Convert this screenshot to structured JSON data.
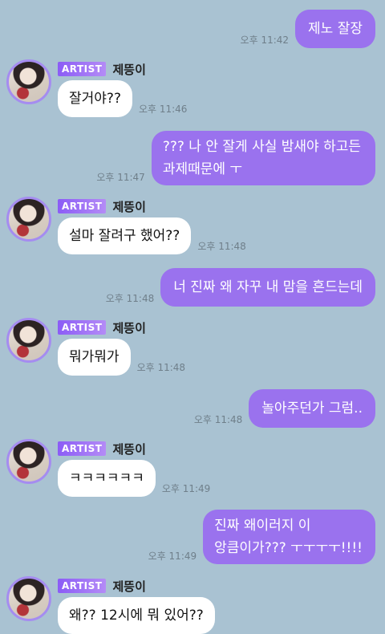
{
  "messages": [
    {
      "dir": "out",
      "lines": [
        "제노 잘장"
      ],
      "time": "오후 11:42"
    },
    {
      "dir": "in",
      "badge": "ARTIST",
      "name": "제뜽이",
      "text": "잘거야??",
      "time": "오후 11:46"
    },
    {
      "dir": "out",
      "lines": [
        "??? 나 안 잘게 사실 밤새야 하고든",
        "과제때문에 ㅜ"
      ],
      "time": "오후 11:47"
    },
    {
      "dir": "in",
      "badge": "ARTIST",
      "name": "제뜽이",
      "text": "설마 잘려구 했어??",
      "time": "오후 11:48"
    },
    {
      "dir": "out",
      "lines": [
        "너 진짜 왜 자꾸 내 맘을 흔드는데"
      ],
      "time": "오후 11:48"
    },
    {
      "dir": "in",
      "badge": "ARTIST",
      "name": "제뜽이",
      "text": "뭐가뭐가",
      "time": "오후 11:48"
    },
    {
      "dir": "out",
      "lines": [
        "놀아주던가 그럼.."
      ],
      "time": "오후 11:48"
    },
    {
      "dir": "in",
      "badge": "ARTIST",
      "name": "제뜽이",
      "text": "ㅋㅋㅋㅋㅋㅋ",
      "time": "오후 11:49"
    },
    {
      "dir": "out",
      "lines": [
        "진짜 왜이러지 이",
        "앙큼이가??? ㅜㅜㅜㅜ!!!!"
      ],
      "time": "오후 11:49"
    },
    {
      "dir": "in",
      "badge": "ARTIST",
      "name": "제뜽이",
      "text": "왜?? 12시에 뭐 있어??",
      "time": ""
    }
  ]
}
